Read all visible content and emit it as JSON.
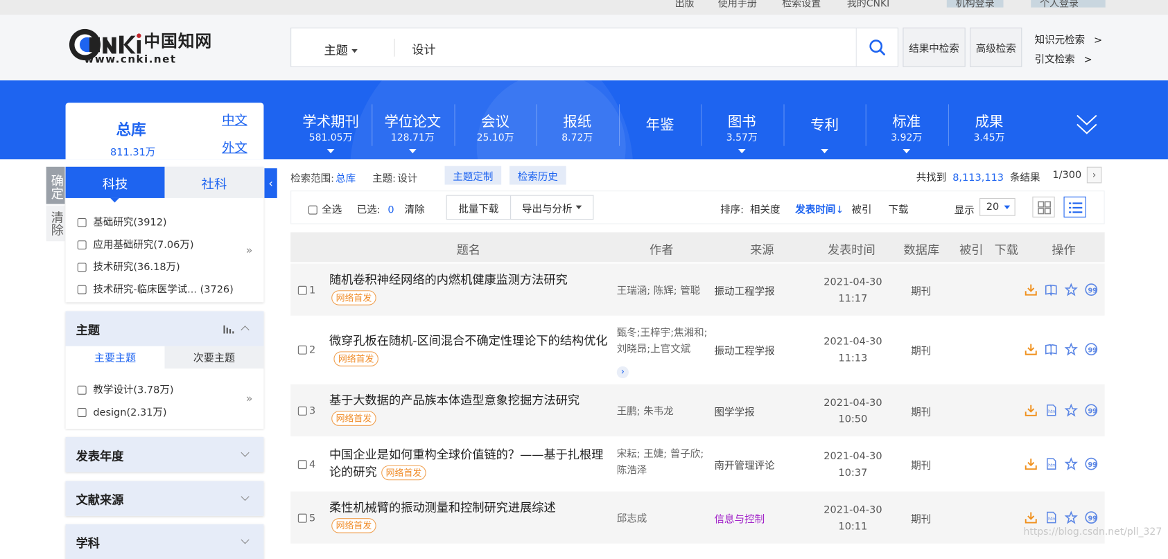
{
  "top_links": [
    "出版",
    "使用手册",
    "检索设置",
    "我的CNKI",
    "机构登录",
    "个人登录"
  ],
  "logo": {
    "cn": "中国知网",
    "url": "www.cnki.net",
    "brand": "CNKI"
  },
  "search": {
    "field": "主题",
    "query": "设计"
  },
  "header_buttons": {
    "within": "结果中检索",
    "advanced": "高级检索",
    "knowledge": "知识元检索",
    "citation": "引文检索"
  },
  "nav": [
    {
      "label": "学术期刊",
      "count": "581.05万"
    },
    {
      "label": "学位论文",
      "count": "128.71万"
    },
    {
      "label": "会议",
      "count": "25.10万"
    },
    {
      "label": "报纸",
      "count": "8.72万"
    },
    {
      "label": "年鉴",
      "count": ""
    },
    {
      "label": "图书",
      "count": "3.57万"
    },
    {
      "label": "专利",
      "count": ""
    },
    {
      "label": "标准",
      "count": "3.92万"
    },
    {
      "label": "成果",
      "count": "3.45万"
    }
  ],
  "zongku": {
    "title": "总库",
    "count": "811.31万",
    "zh": "中文",
    "wai": "外文"
  },
  "side_actions": {
    "confirm": "确定",
    "clear": "清除"
  },
  "side_tabs": {
    "sci": "科技",
    "soc": "社科"
  },
  "categories": [
    "基础研究(3912)",
    "应用基础研究(7.06万)",
    "技术研究(36.18万)",
    "技术研究-临床医学试... (3726)"
  ],
  "topic": {
    "title": "主题",
    "tab_main": "主要主题",
    "tab_sub": "次要主题",
    "items": [
      "教学设计(3.78万)",
      "design(2.31万)"
    ]
  },
  "collapsed": [
    "发表年度",
    "文献来源",
    "学科"
  ],
  "scope": {
    "label": "检索范围:",
    "db": "总库",
    "topic_label": "主题:",
    "topic": "设计",
    "custom": "主题定制",
    "history": "检索历史",
    "found_prefix": "共找到",
    "total": "8,113,113",
    "found_suffix": "条结果",
    "page": "1/300"
  },
  "toolbar": {
    "select_all": "全选",
    "selected": "已选:",
    "selected_count": "0",
    "clear": "清除",
    "batch": "批量下载",
    "export": "导出与分析",
    "sort_label": "排序:",
    "sort_rel": "相关度",
    "sort_time": "发表时间",
    "sort_cite": "被引",
    "sort_dl": "下载",
    "show_label": "显示",
    "show_val": "20"
  },
  "columns": [
    "题名",
    "作者",
    "来源",
    "发表时间",
    "数据库",
    "被引",
    "下载",
    "操作"
  ],
  "rows": [
    {
      "n": "1",
      "title": "随机卷积神经网络的内燃机健康监测方法研究",
      "tag": "网络首发",
      "authors": "王瑞涵; 陈辉; 管聪",
      "source": "振动工程学报",
      "date": "2021-04-30",
      "time": "11:17",
      "db": "期刊"
    },
    {
      "n": "2",
      "title": "微穿孔板在随机-区间混合不确定性理论下的结构优化",
      "tag": "网络首发",
      "authors": "甄冬;王梓宇;焦湘和;刘晓昂;上官文斌",
      "source": "振动工程学报",
      "date": "2021-04-30",
      "time": "11:13",
      "db": "期刊"
    },
    {
      "n": "3",
      "title": "基于大数据的产品族本体造型意象挖掘方法研究",
      "tag": "网络首发",
      "authors": "王鹏; 朱韦龙",
      "source": "图学学报",
      "date": "2021-04-30",
      "time": "10:50",
      "db": "期刊"
    },
    {
      "n": "4",
      "title": "中国企业是如何重构全球价值链的？——基于扎根理论的研究",
      "tag": "网络首发",
      "authors": "宋耘; 王婕; 曾子欣; 陈浩泽",
      "source": "南开管理评论",
      "date": "2021-04-30",
      "time": "10:37",
      "db": "期刊"
    },
    {
      "n": "5",
      "title": "柔性机械臂的振动测量和控制研究进展综述",
      "tag": "网络首发",
      "authors": "邱志成",
      "source": "信息与控制",
      "date": "2021-04-30",
      "time": "10:11",
      "db": "期刊"
    }
  ],
  "watermark": "https://blog.csdn.net/pll_327",
  "colors": {
    "primary": "#1e64f0",
    "tag": "#f08c28",
    "source_link": "#a020c8"
  }
}
